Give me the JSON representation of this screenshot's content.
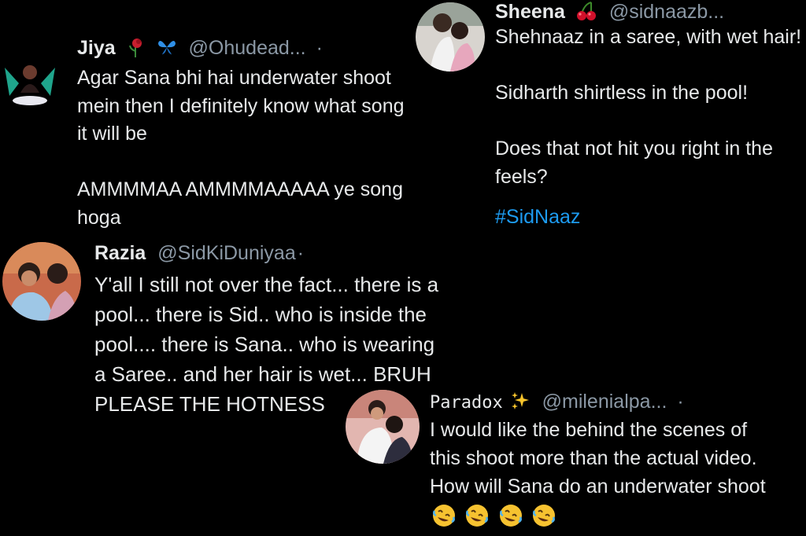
{
  "tweets": {
    "jiya": {
      "name": "Jiya",
      "handle": "@Ohudead...",
      "separator": "·",
      "emoji_icons": [
        "rose-icon",
        "butterfly-icon"
      ],
      "text": "Agar Sana bhi hai underwater shoot\nmein then I definitely know what song\nit will be\n\nAMMMMAA AMMMMAAAAA ye song\nhoga"
    },
    "sheena": {
      "name": "Sheena",
      "handle": "@sidnaazb...",
      "emoji_icons": [
        "cherries-icon"
      ],
      "text": "Shehnaaz in a saree, with wet hair!\n\nSidharth shirtless in the pool!\n\nDoes that not hit you right in the\nfeels?\n",
      "hashtag": "#SidNaaz"
    },
    "razia": {
      "name": "Razia",
      "handle": "@SidKiDuniyaa",
      "separator": "·",
      "text": "Y'all I still not over the fact... there is a\npool... there is Sid.. who is inside the\npool.... there is Sana.. who is wearing\na Saree.. and her hair is wet... BRUH\nPLEASE THE HOTNESS"
    },
    "paradox": {
      "name": "Paradox",
      "handle": "@milenialpa...",
      "separator": "·",
      "emoji_icons": [
        "sparkles-icon"
      ],
      "text": "I would like the behind the scenes of\nthis shoot more than the actual video.\nHow will Sana do an underwater shoot",
      "trailing_emojis": [
        "rofl-icon",
        "rofl-icon",
        "rofl-icon",
        "rofl-icon"
      ]
    }
  },
  "colors": {
    "background": "#000000",
    "text": "#e7e9ea",
    "secondary": "#8b98a5",
    "link": "#1d9bf0"
  }
}
